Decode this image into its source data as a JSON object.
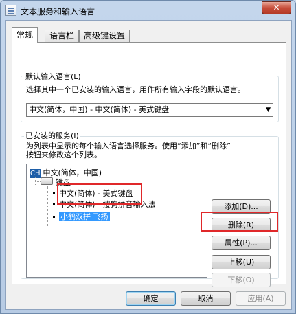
{
  "window": {
    "title": "文本服务和输入语言",
    "close_glyph": "✕"
  },
  "tabs": [
    {
      "label": "常规",
      "active": true
    },
    {
      "label": "语言栏",
      "active": false
    },
    {
      "label": "高级键设置",
      "active": false
    }
  ],
  "default_input": {
    "group_label": "默认输入语言(L)",
    "description": "选择其中一个已安装的输入语言，用作所有输入字段的默认语言。",
    "selected_value": "中文(简体，中国) - 中文(简体) - 美式键盘",
    "arrow_glyph": "▼"
  },
  "installed_services": {
    "group_label": "已安装的服务(I)",
    "description_line1": "为列表中显示的每个输入语言选择服务。使用“添加”和“删除”",
    "description_line2": "按钮来修改这个列表。",
    "tree": {
      "language_badge": "CH",
      "language": "中文(简体，中国)",
      "category": "键盘",
      "items": [
        "中文(简体) - 美式键盘",
        "中文(简体) - 搜狗拼音输入法",
        "小鹤双拼 飞扬"
      ],
      "selected_index": 2
    }
  },
  "side_buttons": {
    "add": "添加(D)...",
    "remove": "删除(R)",
    "properties": "属性(P)...",
    "move_up": "上移(U)",
    "move_down": "下移(O)"
  },
  "footer": {
    "ok": "确定",
    "cancel": "取消",
    "apply": "应用(A)"
  },
  "colors": {
    "annotation": "#e0282a",
    "selection": "#3399ff"
  }
}
